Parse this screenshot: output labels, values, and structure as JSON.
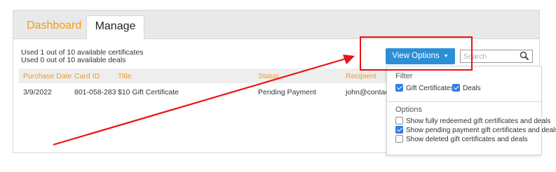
{
  "tabs": [
    {
      "label": "Dashboard",
      "active": false
    },
    {
      "label": "Manage",
      "active": true
    }
  ],
  "usage": {
    "certificates": "Used 1 out of 10 available certificates",
    "deals": "Used 0 out of 10 available deals"
  },
  "toolbar": {
    "view_options_label": "View Options",
    "search_placeholder": "Search"
  },
  "table": {
    "columns": [
      "Purchase Date",
      "Card ID",
      "Title",
      "Status",
      "Recipient"
    ],
    "rows": [
      {
        "purchase_date": "3/9/2022",
        "card_id": "801-058-283",
        "title": "$10 Gift Certificate",
        "status": "Pending Payment",
        "recipient": "john@contact"
      }
    ]
  },
  "view_options_menu": {
    "filter_heading": "Filter",
    "filters": [
      {
        "label": "Gift Certificates",
        "checked": true
      },
      {
        "label": "Deals",
        "checked": true
      }
    ],
    "options_heading": "Options",
    "options": [
      {
        "label": "Show fully redeemed gift certificates and deals",
        "checked": false
      },
      {
        "label": "Show pending payment gift certificates and deals",
        "checked": true
      },
      {
        "label": "Show deleted gift certificates and deals",
        "checked": false
      }
    ]
  },
  "colors": {
    "accent_orange": "#f39a16",
    "button_blue": "#2b8fd6",
    "annotation_red": "#ee1111",
    "checkbox_blue": "#2f7ee6"
  },
  "icons": {
    "search": "search-icon",
    "caret": "caret-down-icon"
  }
}
